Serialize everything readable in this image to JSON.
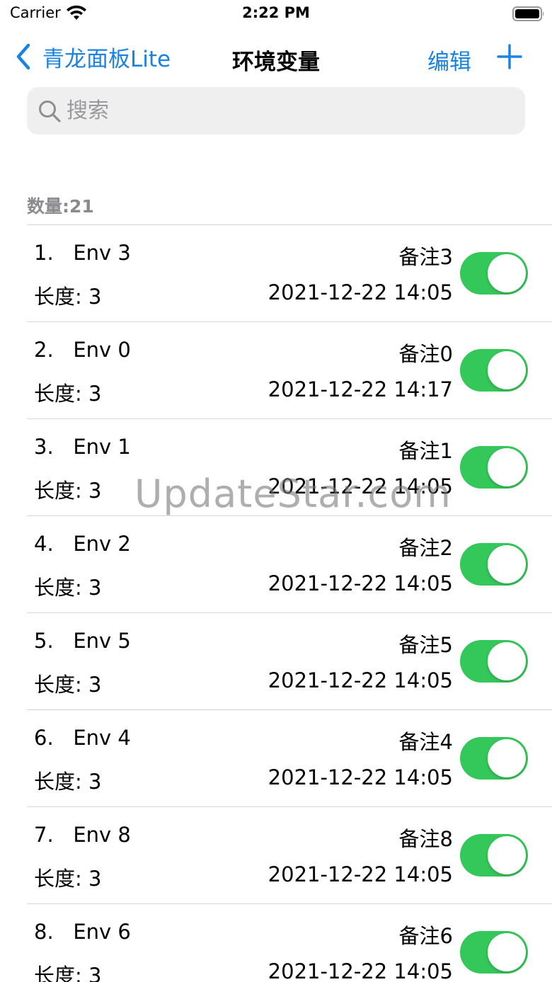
{
  "status_bar": {
    "carrier": "Carrier",
    "time": "2:22 PM"
  },
  "nav": {
    "back_label": "青龙面板Lite",
    "title": "环境变量",
    "edit_label": "编辑"
  },
  "search": {
    "placeholder": "搜索"
  },
  "count_label": "数量:21",
  "items": [
    {
      "index_name": "1.   Env 3",
      "length": "长度: 3",
      "note": "备注3",
      "date": "2021-12-22 14:05",
      "enabled": true
    },
    {
      "index_name": "2.   Env 0",
      "length": "长度: 3",
      "note": "备注0",
      "date": "2021-12-22 14:17",
      "enabled": true
    },
    {
      "index_name": "3.   Env 1",
      "length": "长度: 3",
      "note": "备注1",
      "date": "2021-12-22 14:05",
      "enabled": true
    },
    {
      "index_name": "4.   Env 2",
      "length": "长度: 3",
      "note": "备注2",
      "date": "2021-12-22 14:05",
      "enabled": true
    },
    {
      "index_name": "5.   Env 5",
      "length": "长度: 3",
      "note": "备注5",
      "date": "2021-12-22 14:05",
      "enabled": true
    },
    {
      "index_name": "6.   Env 4",
      "length": "长度: 3",
      "note": "备注4",
      "date": "2021-12-22 14:05",
      "enabled": true
    },
    {
      "index_name": "7.   Env 8",
      "length": "长度: 3",
      "note": "备注8",
      "date": "2021-12-22 14:05",
      "enabled": true
    },
    {
      "index_name": "8.   Env 6",
      "length": "长度: 3",
      "note": "备注6",
      "date": "2021-12-22 14:05",
      "enabled": true
    }
  ],
  "watermark": "UpdateStar.com",
  "colors": {
    "accent": "#1a82e2",
    "toggle_on": "#34c759",
    "search_bg": "#efeff0",
    "separator": "#d8d8dc"
  },
  "icons": {
    "wifi": "wifi-icon",
    "battery": "battery-icon",
    "back": "chevron-left-icon",
    "add": "plus-icon",
    "search": "magnifying-glass-icon"
  }
}
